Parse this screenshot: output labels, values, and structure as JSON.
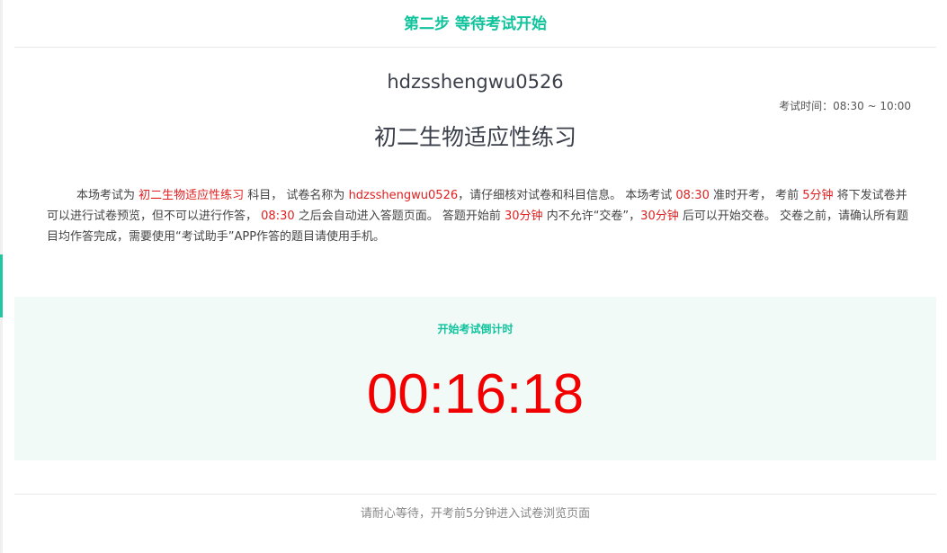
{
  "header": {
    "step_title": "第二步 等待考试开始"
  },
  "exam": {
    "code": "hdzsshengwu0526",
    "time_label": "考试时间：08:30 ~ 10:00",
    "title": "初二生物适应性练习"
  },
  "notice": {
    "p1": "本场考试为 ",
    "subject": "初二生物适应性练习",
    "p2": " 科目， 试卷名称为 ",
    "paper_name": "hdzsshengwu0526",
    "p3": "，请仔细核对试卷和科目信息。 本场考试 ",
    "start_time": "08:30",
    "p4": " 准时开考， 考前 ",
    "preview_minutes": "5分钟",
    "p5": " 将下发试卷并可以进行试卷预览，但不可以进行作答， ",
    "start_time_2": "08:30",
    "p6": " 之后会自动进入答题页面。 答题开始前 ",
    "no_submit_minutes": "30分钟",
    "p7": " 内不允许“交卷”，",
    "submit_minutes": "30分钟",
    "p8": " 后可以开始交卷。 交卷之前，请确认所有题目均作答完成，需要使用“考试助手”APP作答的题目请使用手机。"
  },
  "countdown": {
    "label": "开始考试倒计时",
    "value": "00:16:18"
  },
  "footer": {
    "text": "请耐心等待，开考前5分钟进入试卷浏览页面"
  },
  "colors": {
    "accent": "#10c39d",
    "highlight": "#e02020",
    "countdown": "#f20000",
    "countdown_bg": "#f2faf7"
  }
}
